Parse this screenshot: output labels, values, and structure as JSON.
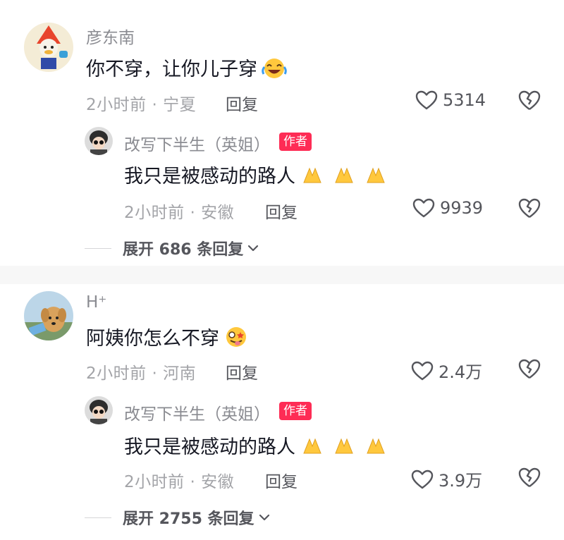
{
  "comments": [
    {
      "author": "彦东南",
      "text": "你不穿，让你儿子穿",
      "emoji": "laughing-crying-emoji",
      "time_location": "2小时前 · 宁夏",
      "reply_label": "回复",
      "likes": "5314",
      "reply": {
        "author": "改写下半生（英姐）",
        "tag": "作者",
        "text": "我只是被感动的路人",
        "emoji": "praying-hands-emoji",
        "time_location": "2小时前 · 安徽",
        "reply_label": "回复",
        "likes": "9939"
      },
      "expand_label": "展开 686 条回复"
    },
    {
      "author": "H⁺",
      "text": "阿姨你怎么不穿",
      "emoji": "starstruck-tongue-emoji",
      "time_location": "2小时前 · 河南",
      "reply_label": "回复",
      "likes": "2.4万",
      "reply": {
        "author": "改写下半生（英姐）",
        "tag": "作者",
        "text": "我只是被感动的路人",
        "emoji": "praying-hands-emoji",
        "time_location": "2小时前 · 安徽",
        "reply_label": "回复",
        "likes": "3.9万"
      },
      "expand_label": "展开 2755 条回复"
    }
  ],
  "colors": {
    "tag": "#fe2c55",
    "text": "#161823",
    "meta": "#a3a4a8"
  }
}
